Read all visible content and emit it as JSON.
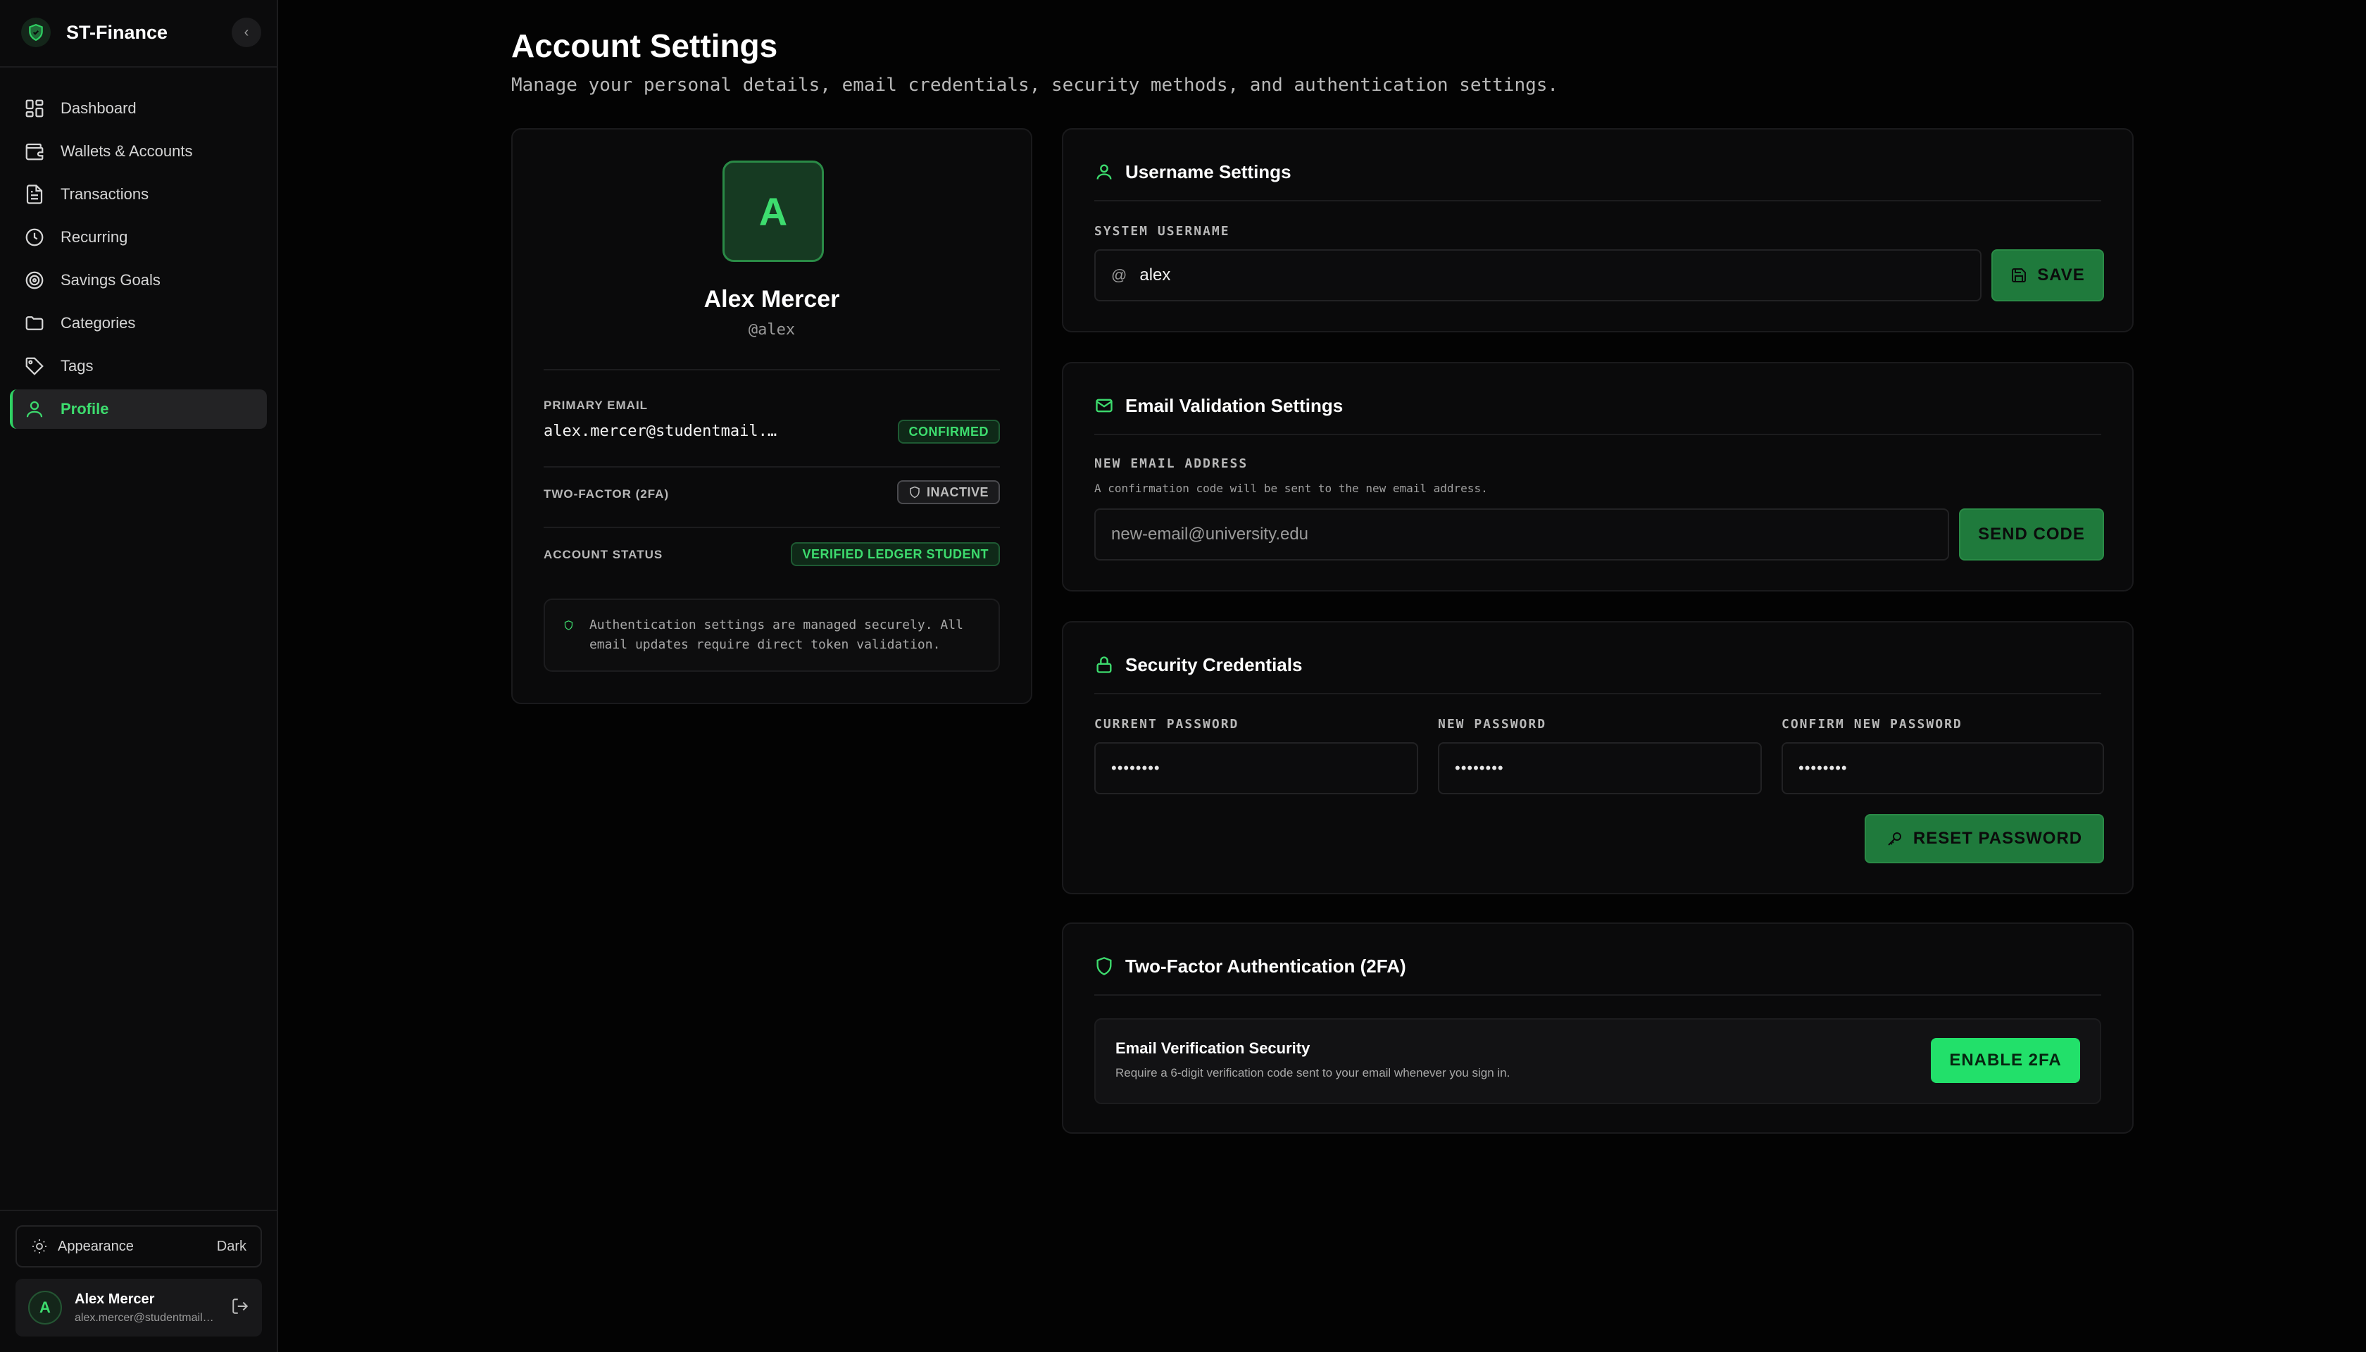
{
  "app": {
    "name": "ST-Finance",
    "collapse_glyph": "‹"
  },
  "sidebar": {
    "items": [
      {
        "label": "Dashboard",
        "icon": "dashboard-icon"
      },
      {
        "label": "Wallets & Accounts",
        "icon": "wallet-icon"
      },
      {
        "label": "Transactions",
        "icon": "receipt-icon"
      },
      {
        "label": "Recurring",
        "icon": "clock-icon"
      },
      {
        "label": "Savings Goals",
        "icon": "target-icon"
      },
      {
        "label": "Categories",
        "icon": "folder-icon"
      },
      {
        "label": "Tags",
        "icon": "tag-icon"
      },
      {
        "label": "Profile",
        "icon": "user-icon",
        "active": true
      }
    ],
    "appearance": {
      "label": "Appearance",
      "value": "Dark"
    },
    "user": {
      "initial": "A",
      "name": "Alex Mercer",
      "email": "alex.mercer@studentmail.com"
    }
  },
  "page": {
    "title": "Account Settings",
    "subtitle": "Manage your personal details, email credentials, security methods, and authentication settings."
  },
  "profile": {
    "initial": "A",
    "name": "Alex Mercer",
    "handle": "@alex",
    "primary_email_label": "PRIMARY EMAIL",
    "primary_email": "alex.mercer@studentmail.com",
    "email_status": "CONFIRMED",
    "twofa_label": "TWO-FACTOR (2FA)",
    "twofa_status": "INACTIVE",
    "account_status_label": "ACCOUNT STATUS",
    "account_status": "VERIFIED LEDGER STUDENT",
    "note": "Authentication settings are managed securely. All email updates require direct token validation."
  },
  "username_settings": {
    "title": "Username Settings",
    "label": "SYSTEM USERNAME",
    "prefix": "@",
    "value": "alex",
    "save_label": "SAVE"
  },
  "email_settings": {
    "title": "Email Validation Settings",
    "label": "NEW EMAIL ADDRESS",
    "note": "A confirmation code will be sent to the new email address.",
    "placeholder": "new-email@university.edu",
    "button_label": "SEND CODE"
  },
  "security": {
    "title": "Security Credentials",
    "current_label": "CURRENT PASSWORD",
    "new_label": "NEW PASSWORD",
    "confirm_label": "CONFIRM NEW PASSWORD",
    "current_value": "••••••••",
    "new_value": "••••••••",
    "confirm_value": "••••••••",
    "button_label": "RESET PASSWORD"
  },
  "twofa": {
    "title": "Two-Factor Authentication (2FA)",
    "box_title": "Email Verification Security",
    "box_desc": "Require a 6-digit verification code sent to your email whenever you sign in.",
    "button_label": "ENABLE 2FA"
  },
  "colors": {
    "accent": "#3ddc6e",
    "accent_dark": "#1f7a3c",
    "background": "#030303",
    "card": "#0a0a0b"
  }
}
